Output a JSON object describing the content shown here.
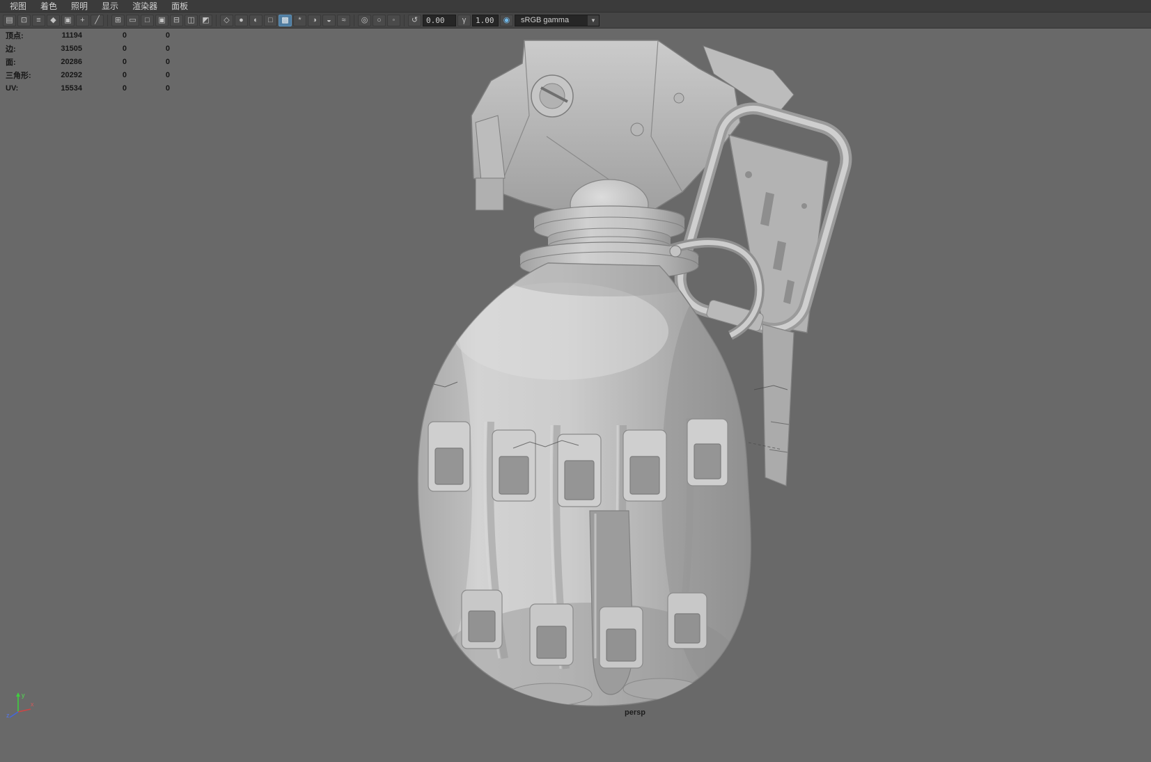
{
  "menubar": {
    "items": [
      {
        "label": "视图"
      },
      {
        "label": "着色"
      },
      {
        "label": "照明"
      },
      {
        "label": "显示"
      },
      {
        "label": "渲染器"
      },
      {
        "label": "面板"
      }
    ]
  },
  "toolbar": {
    "icons": [
      {
        "name": "select-camera-icon",
        "glyph": "▤"
      },
      {
        "name": "lock-camera-icon",
        "glyph": "⊡"
      },
      {
        "name": "camera-attributes-icon",
        "glyph": "≡"
      },
      {
        "name": "bookmark-icon",
        "glyph": "◆"
      },
      {
        "name": "image-plane-icon",
        "glyph": "▣"
      },
      {
        "name": "two-d-pan-zoom-icon",
        "glyph": "+"
      },
      {
        "name": "grease-pencil-icon",
        "glyph": "╱"
      },
      {
        "name": "grid-icon",
        "glyph": "⊞"
      },
      {
        "name": "film-gate-icon",
        "glyph": "▭"
      },
      {
        "name": "resolution-gate-icon",
        "glyph": "□"
      },
      {
        "name": "gate-mask-icon",
        "glyph": "▣"
      },
      {
        "name": "field-chart-icon",
        "glyph": "⊟"
      },
      {
        "name": "safe-action-icon",
        "glyph": "◫"
      },
      {
        "name": "safe-title-icon",
        "glyph": "◩"
      },
      {
        "name": "wireframe-icon",
        "glyph": "◇"
      },
      {
        "name": "smooth-shade-icon",
        "glyph": "●"
      },
      {
        "name": "flat-shade-icon",
        "glyph": "◐"
      },
      {
        "name": "bounding-box-icon",
        "glyph": "□"
      },
      {
        "name": "textured-icon",
        "glyph": "▩"
      },
      {
        "name": "use-all-lights-icon",
        "glyph": "*"
      },
      {
        "name": "shadows-icon",
        "glyph": "◑"
      },
      {
        "name": "ambient-occlusion-icon",
        "glyph": "◒"
      },
      {
        "name": "motion-blur-icon",
        "glyph": "≈"
      },
      {
        "name": "isolate-select-icon",
        "glyph": "◎"
      },
      {
        "name": "x-ray-icon",
        "glyph": "○"
      },
      {
        "name": "joint-x-ray-icon",
        "glyph": "◦"
      },
      {
        "name": "exposure-icon",
        "glyph": "↺"
      },
      {
        "name": "gamma-icon",
        "glyph": "γ"
      },
      {
        "name": "color-management-icon",
        "glyph": "◉"
      }
    ],
    "exposure_value": "0.00",
    "gamma_value": "1.00",
    "view_transform": "sRGB gamma",
    "dropdown_arrow": "▼"
  },
  "hud": {
    "rows": [
      {
        "label": "顶点:",
        "total": "11194",
        "c2": "0",
        "c3": "0"
      },
      {
        "label": "边:",
        "total": "31505",
        "c2": "0",
        "c3": "0"
      },
      {
        "label": "面:",
        "total": "20286",
        "c2": "0",
        "c3": "0"
      },
      {
        "label": "三角形:",
        "total": "20292",
        "c2": "0",
        "c3": "0"
      },
      {
        "label": "UV:",
        "total": "15534",
        "c2": "0",
        "c3": "0"
      }
    ]
  },
  "viewport": {
    "camera_label": "persp"
  },
  "axis_gizmo": {
    "x_label": "x",
    "y_label": "y",
    "z_label": "z"
  },
  "colors": {
    "viewport_background": "#696969",
    "menubar_background": "#3b3b3b",
    "toolbar_background": "#454545",
    "field_background": "#262626",
    "selected_icon": "#4f7ca0",
    "axis_x": "#d04444",
    "axis_y": "#3fcf3f",
    "axis_z": "#4466dd",
    "model_light": "#d2d2d2",
    "model_dark": "#8e8e8e"
  }
}
